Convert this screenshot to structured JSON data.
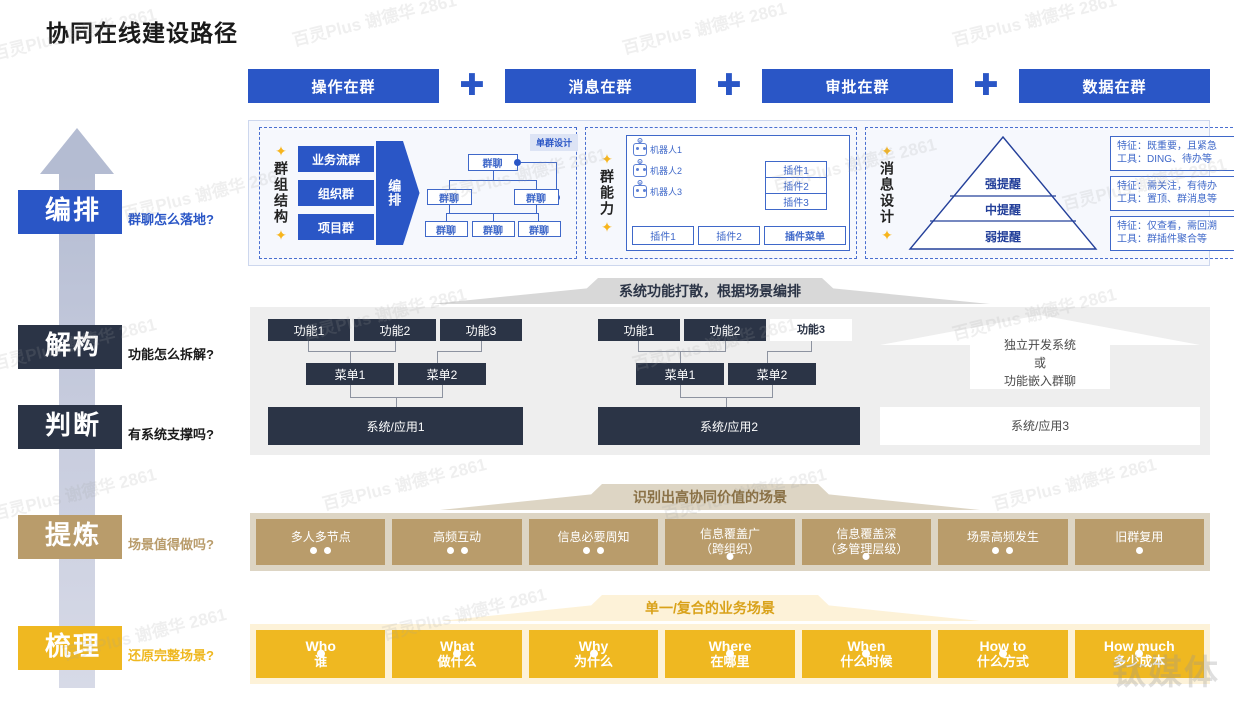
{
  "page": {
    "title": "协同在线建设路径"
  },
  "top_buttons": [
    {
      "label": "操作在群"
    },
    {
      "label": "消息在群"
    },
    {
      "label": "审批在群"
    },
    {
      "label": "数据在群"
    }
  ],
  "plus_separator": "✚",
  "stages": [
    {
      "name": "编排",
      "question": "群聊怎么落地?",
      "color": "#2a56c6",
      "question_color": "#2a56c6"
    },
    {
      "name": "解构",
      "question": "功能怎么拆解?",
      "color": "#2b3446",
      "question_color": "#1a1a1a"
    },
    {
      "name": "判断",
      "question": "有系统支撑吗?",
      "color": "#2b3446",
      "question_color": "#1a1a1a"
    },
    {
      "name": "提炼",
      "question": "场景值得做吗?",
      "color": "#b99c6b",
      "question_color": "#b99c6b"
    },
    {
      "name": "梳理",
      "question": "还原完整场景?",
      "color": "#efb821",
      "question_color": "#efb821"
    }
  ],
  "orchestration": {
    "panel_group_structure": {
      "vertical_label": "群组结构",
      "star_glyph": "✦",
      "group_types": [
        "业务流群",
        "组织群",
        "项目群"
      ],
      "arrow_label": "编排",
      "tree_node_label": "群聊",
      "single_design_label": "单群设计"
    },
    "panel_group_ability": {
      "vertical_label": "群能力",
      "star_glyph": "✦",
      "robots": [
        "机器人1",
        "机器人2",
        "机器人3"
      ],
      "plugin_stack": [
        "插件1",
        "插件2",
        "插件3"
      ],
      "plugin_bottom": [
        "插件1",
        "插件2",
        "插件菜单"
      ]
    },
    "panel_message_design": {
      "vertical_label": "消息设计",
      "star_glyph": "✦",
      "pyramid_levels": [
        "强提醒",
        "中提醒",
        "弱提醒"
      ],
      "details": [
        {
          "feature": "特征：既重要，且紧急",
          "tools": "工具：DING、待办等"
        },
        {
          "feature": "特征：需关注，有待办",
          "tools": "工具：置顶、群消息等"
        },
        {
          "feature": "特征：仅查看，需回溯",
          "tools": "工具：群插件聚合等"
        }
      ]
    }
  },
  "banners": {
    "decompose": {
      "text": "系统功能打散，根据场景编排",
      "fill": "#d8d8d8",
      "text_color": "#2b3446"
    },
    "refine": {
      "text": "识别出高协同价值的场景",
      "fill": "#ddd5c4",
      "text_color": "#8a7146"
    },
    "sort": {
      "text": "单一/复合的业务场景",
      "fill": "#fdf2d8",
      "text_color": "#d9a21a"
    }
  },
  "decompose": {
    "column_1": {
      "functions": [
        "功能1",
        "功能2",
        "功能3"
      ],
      "menus": [
        "菜单1",
        "菜单2"
      ],
      "system": "系统/应用1"
    },
    "column_2": {
      "functions": [
        "功能1",
        "功能2",
        "功能3"
      ],
      "menus": [
        "菜单1",
        "菜单2"
      ],
      "system": "系统/应用2"
    },
    "column_3": {
      "note_lines": [
        "独立开发系统",
        "或",
        "功能嵌入群聊"
      ],
      "system": "系统/应用3"
    }
  },
  "refine_items": [
    {
      "line1": "多人多节点",
      "line2": "",
      "dots": 2
    },
    {
      "line1": "高频互动",
      "line2": "",
      "dots": 2
    },
    {
      "line1": "信息必要周知",
      "line2": "",
      "dots": 2
    },
    {
      "line1": "信息覆盖广",
      "line2": "（跨组织）",
      "dots": 1
    },
    {
      "line1": "信息覆盖深",
      "line2": "（多管理层级）",
      "dots": 1
    },
    {
      "line1": "场景高频发生",
      "line2": "",
      "dots": 2
    },
    {
      "line1": "旧群复用",
      "line2": "",
      "dots": 1
    }
  ],
  "sort_items": [
    {
      "en": "Who",
      "cn": "谁"
    },
    {
      "en": "What",
      "cn": "做什么"
    },
    {
      "en": "Why",
      "cn": "为什么"
    },
    {
      "en": "Where",
      "cn": "在哪里"
    },
    {
      "en": "When",
      "cn": "什么时候"
    },
    {
      "en": "How to",
      "cn": "什么方式"
    },
    {
      "en": "How much",
      "cn": "多少成本"
    }
  ],
  "watermarks": {
    "text": "百灵Plus 谢德华 2861",
    "logo": "钛媒体"
  }
}
